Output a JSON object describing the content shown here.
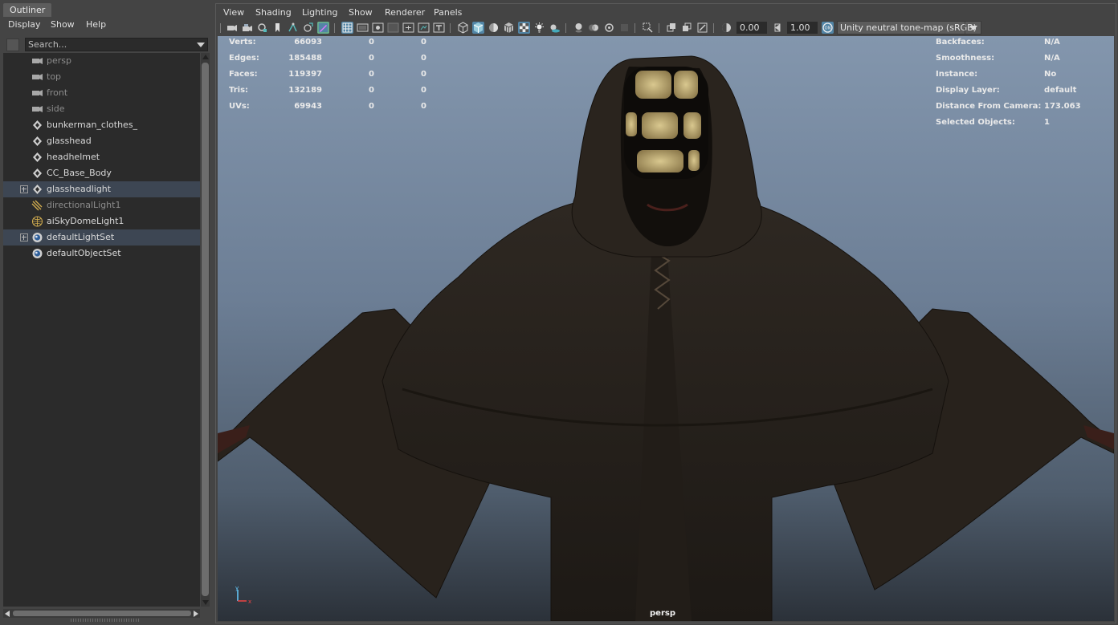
{
  "outliner": {
    "tab_title": "Outliner",
    "menu": [
      "Display",
      "Show",
      "Help"
    ],
    "search_placeholder": "Search...",
    "items": [
      {
        "label": "persp",
        "icon": "camera-icon",
        "dim": true,
        "selected": false,
        "expandable": false
      },
      {
        "label": "top",
        "icon": "camera-icon",
        "dim": true,
        "selected": false,
        "expandable": false
      },
      {
        "label": "front",
        "icon": "camera-icon",
        "dim": true,
        "selected": false,
        "expandable": false
      },
      {
        "label": "side",
        "icon": "camera-icon",
        "dim": true,
        "selected": false,
        "expandable": false
      },
      {
        "label": "bunkerman_clothes_",
        "icon": "mesh-icon",
        "dim": false,
        "selected": false,
        "expandable": false
      },
      {
        "label": "glasshead",
        "icon": "mesh-icon",
        "dim": false,
        "selected": false,
        "expandable": false
      },
      {
        "label": "headhelmet",
        "icon": "mesh-icon",
        "dim": false,
        "selected": false,
        "expandable": false
      },
      {
        "label": "CC_Base_Body",
        "icon": "mesh-icon",
        "dim": false,
        "selected": false,
        "expandable": false
      },
      {
        "label": "glassheadlight",
        "icon": "mesh-icon",
        "dim": false,
        "selected": true,
        "expandable": true
      },
      {
        "label": "directionalLight1",
        "icon": "directional-light-icon",
        "dim": true,
        "selected": false,
        "expandable": false
      },
      {
        "label": "aiSkyDomeLight1",
        "icon": "skydome-light-icon",
        "dim": false,
        "selected": false,
        "expandable": false
      },
      {
        "label": "defaultLightSet",
        "icon": "set-icon",
        "dim": false,
        "selected": true,
        "expandable": true
      },
      {
        "label": "defaultObjectSet",
        "icon": "set-icon",
        "dim": false,
        "selected": false,
        "expandable": false
      }
    ]
  },
  "panel": {
    "menu": [
      "View",
      "Shading",
      "Lighting",
      "Show",
      "Renderer",
      "Panels"
    ],
    "exposure": "0.00",
    "gamma": "1.00",
    "tone_map": "Unity neutral tone-map (sRGB)",
    "camera_name": "persp"
  },
  "hud_stats": [
    {
      "label": "Verts:",
      "v1": "66093",
      "v2": "0",
      "v3": "0"
    },
    {
      "label": "Edges:",
      "v1": "185488",
      "v2": "0",
      "v3": "0"
    },
    {
      "label": "Faces:",
      "v1": "119397",
      "v2": "0",
      "v3": "0"
    },
    {
      "label": "Tris:",
      "v1": "132189",
      "v2": "0",
      "v3": "0"
    },
    {
      "label": "UVs:",
      "v1": "69943",
      "v2": "0",
      "v3": "0"
    }
  ],
  "hud_info": [
    {
      "label": "Backfaces:",
      "value": "N/A"
    },
    {
      "label": "Smoothness:",
      "value": "N/A"
    },
    {
      "label": "Instance:",
      "value": "No"
    },
    {
      "label": "Display Layer:",
      "value": "default"
    },
    {
      "label": "Distance From Camera:",
      "value": "173.063"
    },
    {
      "label": "Selected Objects:",
      "value": "1"
    }
  ],
  "gizmo": {
    "y": "y",
    "x": "x"
  },
  "colors": {
    "selection_row": "#3d4653",
    "active_toggle": "#5285a6",
    "viewport_top": "#8396ad",
    "viewport_bottom": "#2b3139",
    "robe": "#2a241e",
    "glass_glow": "#c9b47a"
  }
}
